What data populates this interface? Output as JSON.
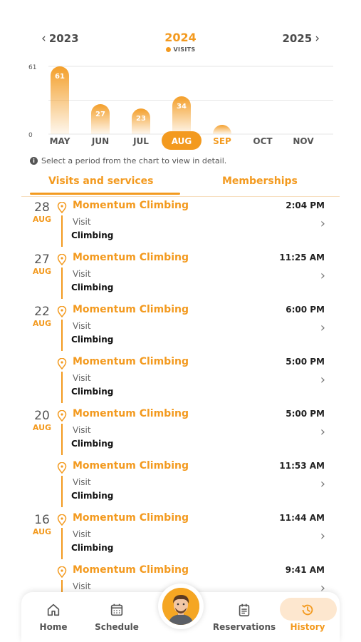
{
  "year_nav": {
    "prev": "2023",
    "current": "2024",
    "next": "2025",
    "legend": "VISITS"
  },
  "chart_data": {
    "type": "bar",
    "categories": [
      "MAY",
      "JUN",
      "JUL",
      "AUG",
      "SEP",
      "OCT",
      "NOV"
    ],
    "series": [
      {
        "name": "VISITS",
        "values": [
          61,
          27,
          23,
          34,
          3,
          0,
          0
        ]
      }
    ],
    "data_labels": [
      "61",
      "27",
      "23",
      "34",
      "",
      "",
      ""
    ],
    "selected": "AUG",
    "ylim": [
      0,
      61
    ],
    "yticks": [
      "0",
      "61"
    ],
    "grid": true,
    "colors": {
      "bar": "#f39a1f",
      "selected": "#f39a1f",
      "axis_text": "#555555"
    }
  },
  "hint": "Select a period from the chart to view in detail.",
  "tabs": [
    {
      "label": "Visits and services",
      "active": true
    },
    {
      "label": "Memberships",
      "active": false
    }
  ],
  "entries": [
    {
      "day": "28",
      "month": "AUG",
      "place": "Momentum Climbing",
      "time": "2:04 PM",
      "kind": "Visit",
      "service": "Climbing"
    },
    {
      "day": "27",
      "month": "AUG",
      "place": "Momentum Climbing",
      "time": "11:25 AM",
      "kind": "Visit",
      "service": "Climbing"
    },
    {
      "day": "22",
      "month": "AUG",
      "place": "Momentum Climbing",
      "time": "6:00 PM",
      "kind": "Visit",
      "service": "Climbing"
    },
    {
      "day": "",
      "month": "",
      "place": "Momentum Climbing",
      "time": "5:00 PM",
      "kind": "Visit",
      "service": "Climbing"
    },
    {
      "day": "20",
      "month": "AUG",
      "place": "Momentum Climbing",
      "time": "5:00 PM",
      "kind": "Visit",
      "service": "Climbing"
    },
    {
      "day": "",
      "month": "",
      "place": "Momentum Climbing",
      "time": "11:53 AM",
      "kind": "Visit",
      "service": "Climbing"
    },
    {
      "day": "16",
      "month": "AUG",
      "place": "Momentum Climbing",
      "time": "11:44 AM",
      "kind": "Visit",
      "service": "Climbing"
    },
    {
      "day": "",
      "month": "",
      "place": "Momentum Climbing",
      "time": "9:41 AM",
      "kind": "Visit",
      "service": ""
    }
  ],
  "bottom_nav": {
    "home": {
      "label": "Home",
      "icon": "home-icon"
    },
    "schedule": {
      "label": "Schedule",
      "icon": "calendar-icon"
    },
    "reservations": {
      "label": "Reservations",
      "icon": "clipboard-icon"
    },
    "history": {
      "label": "History",
      "icon": "history-icon",
      "active": true
    }
  },
  "colors": {
    "accent": "#f39a1f",
    "accent_light": "#fde7cf"
  }
}
